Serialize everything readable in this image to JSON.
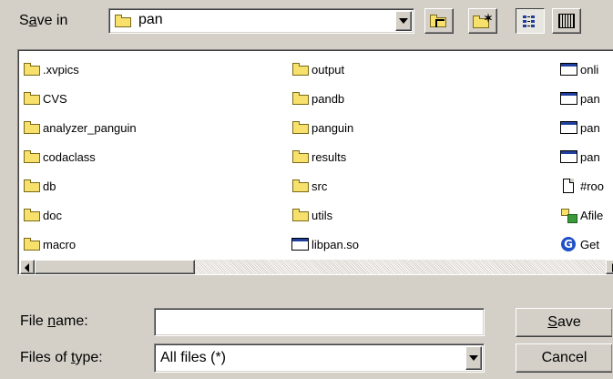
{
  "save_in": {
    "label_pre": "S",
    "label_key": "a",
    "label_post": "ve in",
    "value": "pan"
  },
  "toolbar": {
    "up_icon": "folder-up-icon",
    "new_folder_icon": "new-folder-icon",
    "list_view_icon": "list-view-icon",
    "details_view_icon": "details-view-icon"
  },
  "files": {
    "col1": [
      ".xvpics",
      "CVS",
      "analyzer_panguin",
      "codaclass",
      "db",
      "doc",
      "macro"
    ],
    "col2": [
      "output",
      "pandb",
      "panguin",
      "results",
      "src",
      "utils",
      "libpan.so"
    ],
    "col3": [
      "onli",
      "pan",
      "pan",
      "pan",
      "#roo",
      "Afile",
      "Get"
    ]
  },
  "file_name": {
    "label_pre": "File ",
    "label_key": "n",
    "label_post": "ame:",
    "value": ""
  },
  "file_type": {
    "label_pre": "Files of ",
    "label_key": "t",
    "label_post": "ype:",
    "value": "All files (*)"
  },
  "buttons": {
    "save_key": "S",
    "save_rest": "ave",
    "cancel": "Cancel"
  },
  "colors": {
    "face": "#d4d0c8",
    "folder": "#f7e06c",
    "titlebar_blue": "#1f3f9f"
  }
}
